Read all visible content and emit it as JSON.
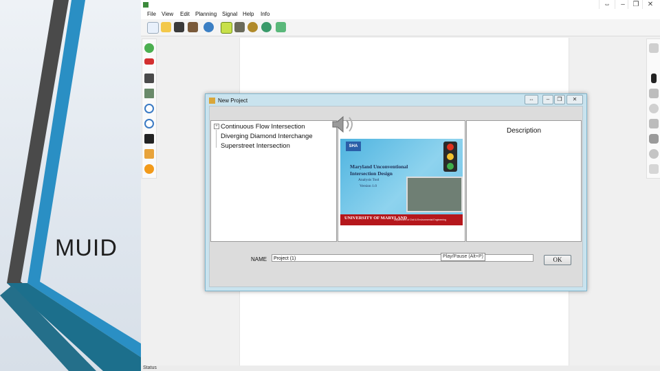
{
  "slide": {
    "title": "MUID",
    "colors": {
      "stripe_dark": "#4a4a4a",
      "stripe_blue": "#2a8fc4",
      "stripe_teal": "#1c6f8c"
    }
  },
  "app": {
    "window_buttons": [
      "⇔",
      "–",
      "❐",
      "✕"
    ],
    "menu": [
      "File",
      "View",
      "Edit",
      "Planning",
      "Signal",
      "Help",
      "Info"
    ],
    "toolbar_icons": [
      "new-icon",
      "open-icon",
      "save-icon",
      "edit-icon",
      "refresh-icon",
      "play-icon",
      "tools-icon",
      "settings-icon",
      "help-icon",
      "export-icon"
    ],
    "left_toolbar_icons": [
      "exit-icon",
      "car-icon",
      "road-icon",
      "map-icon",
      "zoom-out-icon",
      "zoom-in-icon",
      "measure-icon",
      "palette-icon",
      "info-icon"
    ],
    "right_toolbar_icons": [
      "bus-icon",
      "separator-icon",
      "traffic-light-icon",
      "train-icon",
      "clock-icon",
      "signal-icon",
      "vehicle-icon",
      "pedestrian-icon",
      "document-icon"
    ],
    "status": "Status"
  },
  "dialog": {
    "title": "New Project",
    "buttons": [
      "⇔",
      "–",
      "❐",
      "✕"
    ],
    "tree": [
      "Continuous Flow Intersection",
      "Diverging Diamond Interchange",
      "Superstreet Intersection"
    ],
    "preview": {
      "logo": "SHA",
      "title_line1": "Maryland Unconventional",
      "title_line2": "Intersection Design",
      "subtitle": "Analysis Tool",
      "version": "Version 1.0",
      "university": "UNIVERSITY OF MARYLAND",
      "department": "Department of Civil & Environmental Engineering"
    },
    "description_title": "Description",
    "name_label": "NAME",
    "name_value": "Project (1)",
    "tooltip": "Play/Pause (Alt+P)",
    "ok_label": "OK"
  }
}
